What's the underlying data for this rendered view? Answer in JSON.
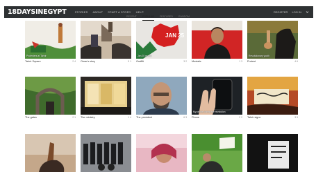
{
  "brand": {
    "logo": "18DAYSINEGYPT"
  },
  "nav": {
    "items": [
      "Stories",
      "About",
      "Start a story",
      "Help"
    ]
  },
  "account": {
    "items": [
      "Register",
      "Log in"
    ]
  },
  "filters": {
    "items": [
      "Recent",
      "Popular",
      "Featured",
      "Random"
    ],
    "active_index": 1
  },
  "cards": [
    {
      "title": "Tahrir Square",
      "caption": "Protesters at Tahrir",
      "counts": "2  4"
    },
    {
      "title": "Omar's story",
      "caption": "",
      "counts": "5  1"
    },
    {
      "title": "Graffiti",
      "caption": "Jan 25 graffiti",
      "counts": "3  2"
    },
    {
      "title": "Mostafa",
      "caption": "",
      "counts": "1  3"
    },
    {
      "title": "Protest",
      "caption": "Revolutionary youth",
      "counts": "4  6"
    },
    {
      "title": "The gates",
      "caption": "",
      "counts": "2  1"
    },
    {
      "title": "The ministry",
      "caption": "",
      "counts": "1  4"
    },
    {
      "title": "The president",
      "caption": "",
      "counts": "6  3"
    },
    {
      "title": "Phone",
      "caption": "My phone during the revolution",
      "counts": "2  2"
    },
    {
      "title": "Tahrir signs",
      "caption": "",
      "counts": "3  5"
    },
    {
      "title": "",
      "caption": "",
      "counts": ""
    },
    {
      "title": "",
      "caption": "",
      "counts": ""
    },
    {
      "title": "",
      "caption": "",
      "counts": ""
    },
    {
      "title": "",
      "caption": "",
      "counts": ""
    },
    {
      "title": "",
      "caption": "",
      "counts": ""
    }
  ]
}
